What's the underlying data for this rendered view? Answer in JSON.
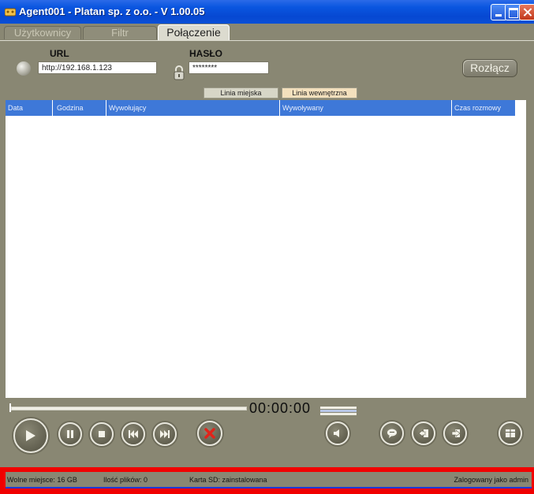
{
  "window": {
    "title": "Agent001 - Platan sp. z o.o. - V 1.00.05"
  },
  "tabs": [
    {
      "label": "Użytkownicy"
    },
    {
      "label": "Filtr"
    },
    {
      "label": "Połączenie"
    }
  ],
  "connection": {
    "url_label": "URL",
    "url_value": "http://192.168.1.123",
    "password_label": "HASŁO",
    "password_value": "********",
    "disconnect_label": "Rozłącz"
  },
  "line_buttons": {
    "city": "Linia miejska",
    "internal": "Linia wewnętrzna"
  },
  "table": {
    "columns": [
      "Data",
      "Godzina",
      "Wywołujący",
      "Wywoływany",
      "Czas rozmowy"
    ],
    "rows": []
  },
  "player": {
    "time": "00:00:00"
  },
  "status": {
    "free_space": "Wolne miejsce: 16 GB",
    "file_count": "Ilość plików: 0",
    "sd_card": "Karta SD: zainstalowana",
    "logged_in": "Zalogowany jako admin"
  },
  "colors": {
    "window_bg": "#898773",
    "titlebar": "#0a56e0",
    "table_header": "#3e78d8",
    "status_highlight": "#f10000",
    "city_line_btn": "#d7d6c7",
    "internal_line_btn": "#f3e0bd"
  }
}
